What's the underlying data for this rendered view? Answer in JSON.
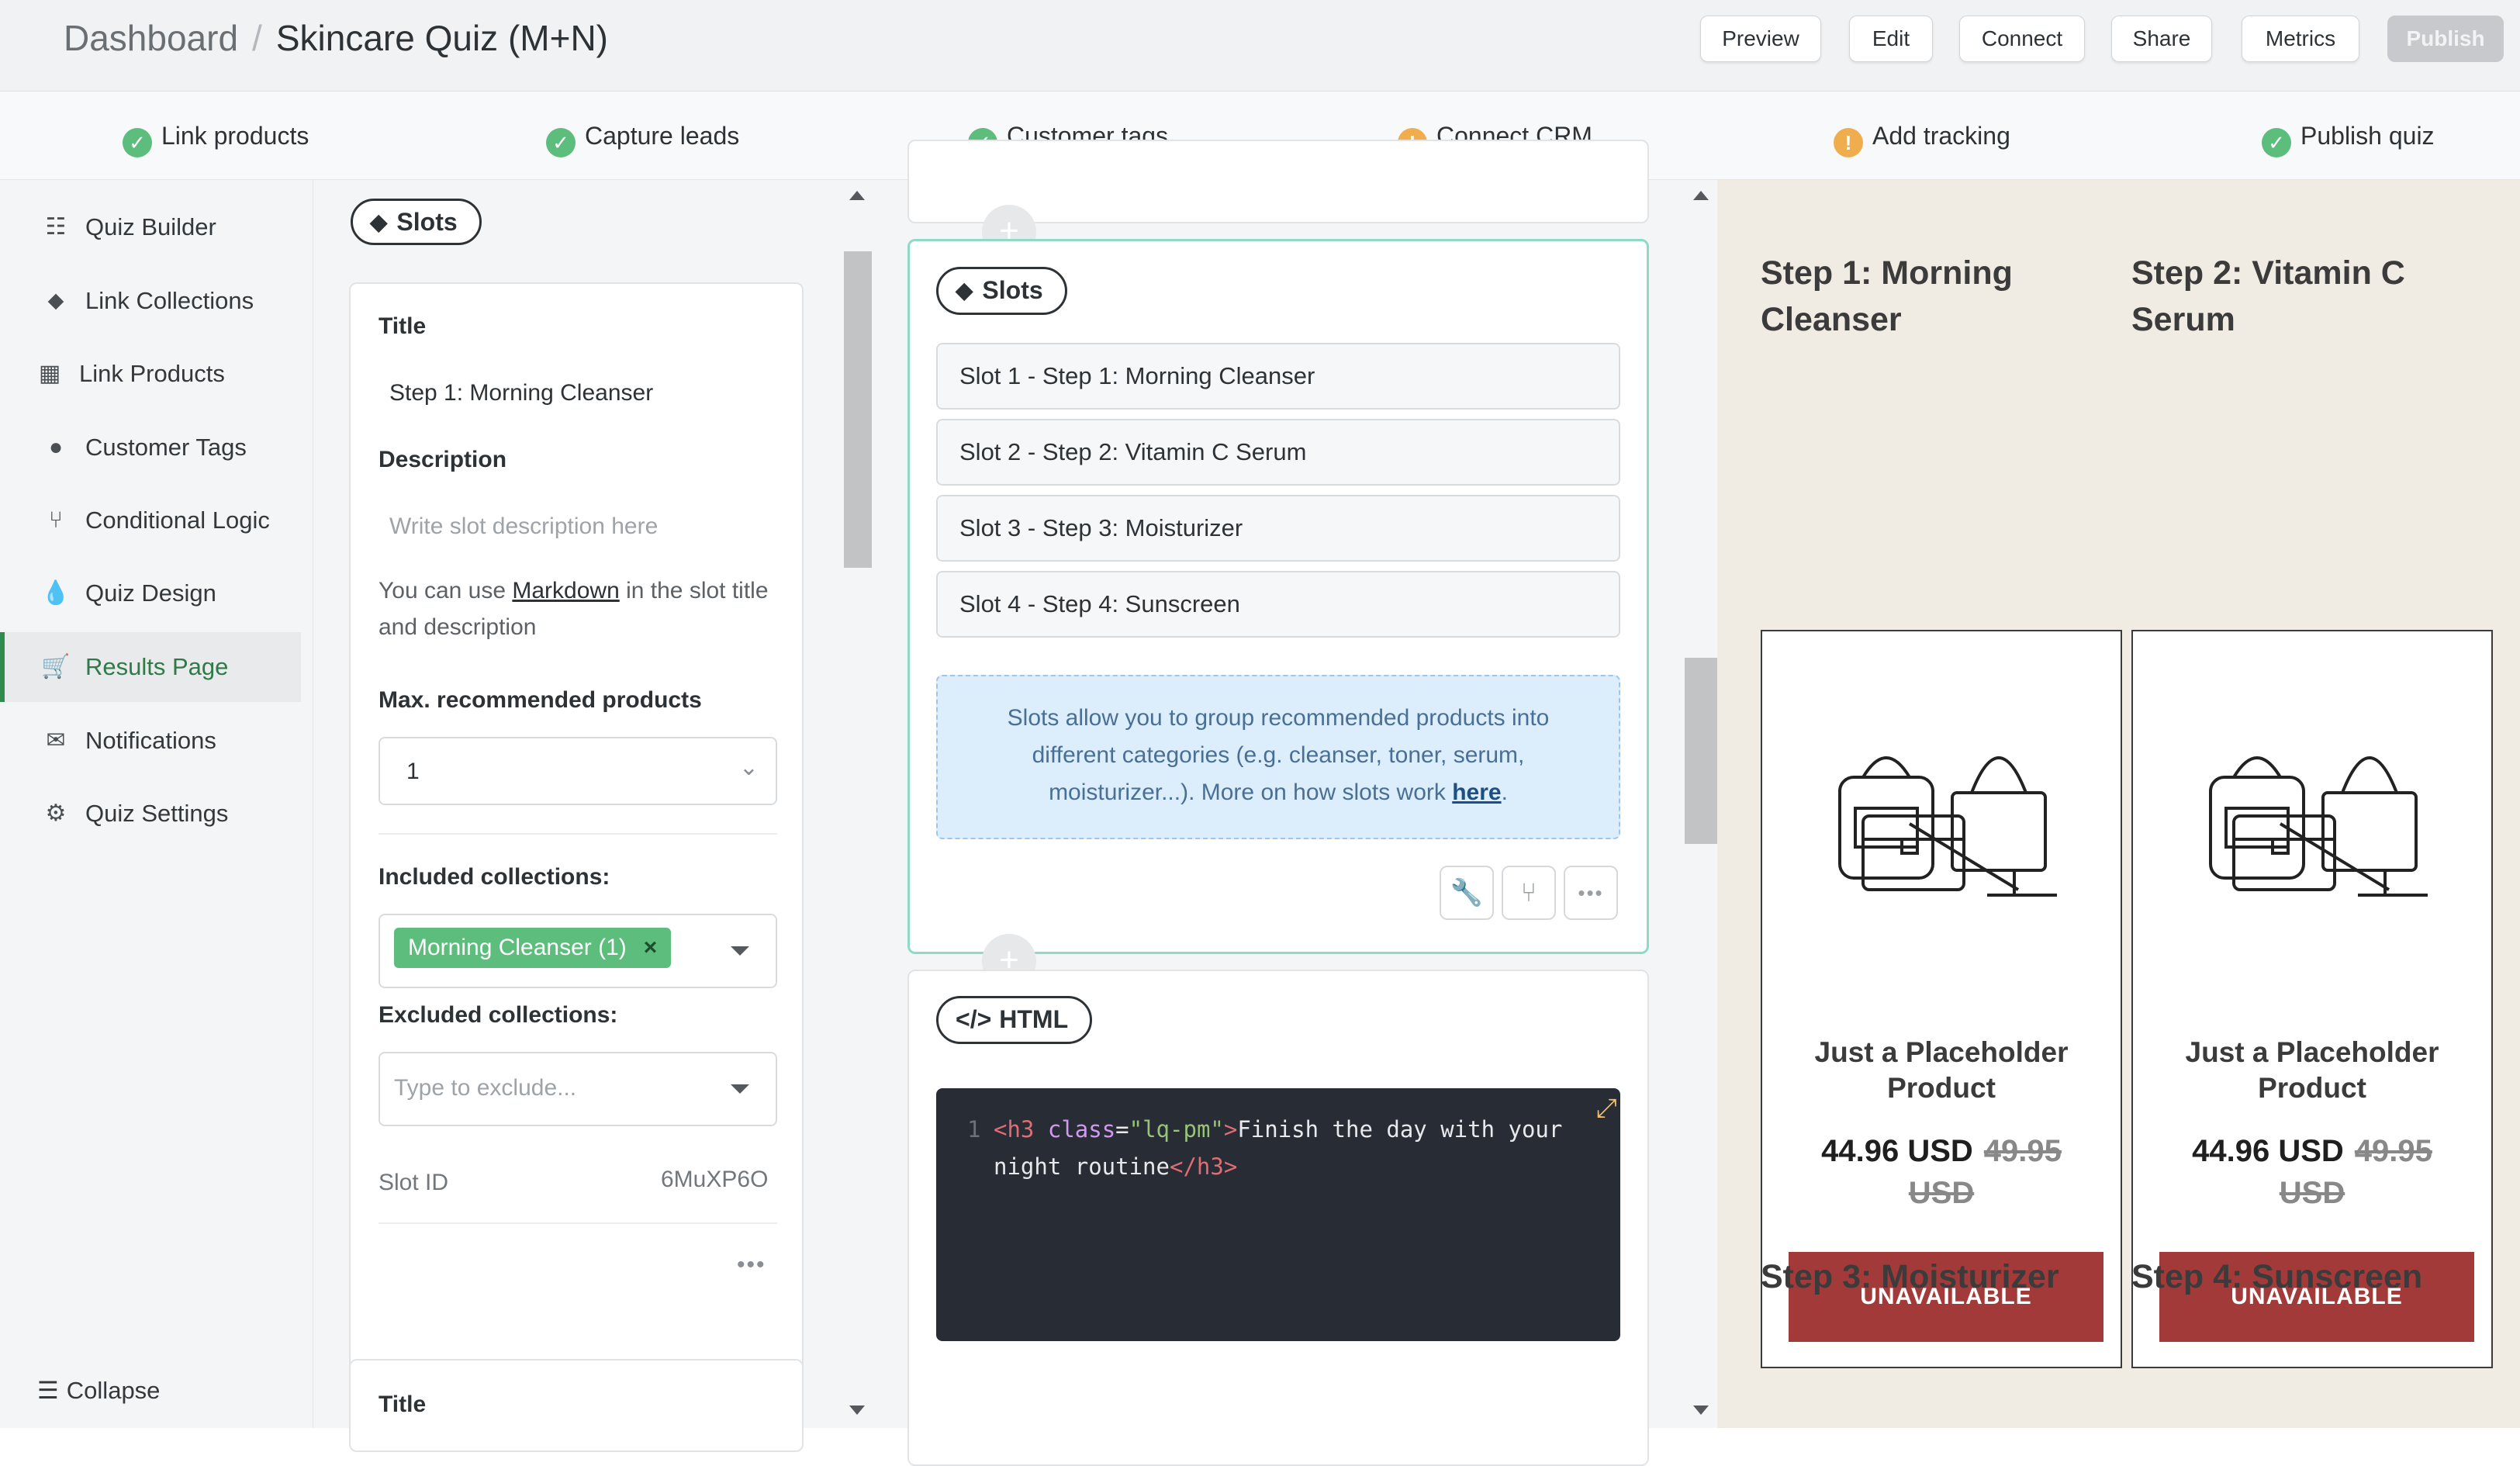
{
  "breadcrumb": {
    "parent": "Dashboard",
    "current": "Skincare Quiz (M+N)"
  },
  "toolbar": {
    "preview": "Preview",
    "edit": "Edit",
    "connect": "Connect",
    "share": "Share",
    "metrics": "Metrics",
    "publish": "Publish"
  },
  "checklist": [
    {
      "label": "Link products",
      "status": "done"
    },
    {
      "label": "Capture leads",
      "status": "done"
    },
    {
      "label": "Customer tags",
      "status": "done"
    },
    {
      "label": "Connect CRM",
      "status": "warning"
    },
    {
      "label": "Add tracking",
      "status": "warning"
    },
    {
      "label": "Publish quiz",
      "status": "done"
    }
  ],
  "sidebar": {
    "items": [
      {
        "label": "Quiz Builder",
        "icon": "list-icon"
      },
      {
        "label": "Link Collections",
        "icon": "tag-icon"
      },
      {
        "label": "Link Products",
        "icon": "box-icon"
      },
      {
        "label": "Customer Tags",
        "icon": "user-icon"
      },
      {
        "label": "Conditional Logic",
        "icon": "branch-icon"
      },
      {
        "label": "Quiz Design",
        "icon": "droplet-icon"
      },
      {
        "label": "Results Page",
        "icon": "cart-icon",
        "active": true
      },
      {
        "label": "Notifications",
        "icon": "envelope-icon"
      },
      {
        "label": "Quiz Settings",
        "icon": "gear-icon"
      }
    ],
    "collapse": "Collapse"
  },
  "slot_editor": {
    "pill": "Slots",
    "title_label": "Title",
    "title_value": "Step 1: Morning Cleanser",
    "description_label": "Description",
    "description_placeholder": "Write slot description here",
    "hint_pre": "You can use ",
    "hint_link": "Markdown",
    "hint_post": " in the slot title and description",
    "max_label": "Max. recommended products",
    "max_value": "1",
    "included_label": "Included collections:",
    "included_tag": "Morning Cleanser (1)",
    "excluded_label": "Excluded collections:",
    "excluded_placeholder": "Type to exclude...",
    "slot_id_label": "Slot ID",
    "slot_id_value": "6MuXP6O",
    "next_title_label": "Title"
  },
  "builder": {
    "slots_pill": "Slots",
    "slots": [
      "Slot 1 - Step 1: Morning Cleanser",
      "Slot 2 - Step 2: Vitamin C Serum",
      "Slot 3 - Step 3: Moisturizer",
      "Slot 4 - Step 4: Sunscreen"
    ],
    "info_text": "Slots allow you to group recommended products into different categories (e.g. cleanser, toner, serum, moisturizer...). More on how slots work ",
    "info_link": "here",
    "info_end": ".",
    "html_pill": "HTML",
    "code": {
      "line_no": "1",
      "open_tag": "<h3",
      "attr": "class",
      "eq": "=",
      "str": "\"lq-pm\"",
      "gt": ">",
      "text1": "Finish the day with your",
      "text2": "night routine",
      "close_tag": "</h3>"
    }
  },
  "preview": {
    "step_titles": [
      "Step 1: Morning Cleanser",
      "Step 2: Vitamin C Serum",
      "Step 3: Moisturizer",
      "Step 4: Sunscreen"
    ],
    "products": [
      {
        "name": "Just a Placeholder Product",
        "price": "44.96 USD",
        "old_price": "49.95",
        "old_currency": "USD",
        "button": "UNAVAILABLE"
      },
      {
        "name": "Just a Placeholder Product",
        "price": "44.96 USD",
        "old_price": "49.95",
        "old_currency": "USD",
        "button": "UNAVAILABLE"
      }
    ]
  },
  "colors": {
    "accent_green": "#5cbd7d",
    "warning": "#f0ad4e",
    "unavailable": "#a33a3a",
    "preview_bg": "#f0ebe3"
  }
}
